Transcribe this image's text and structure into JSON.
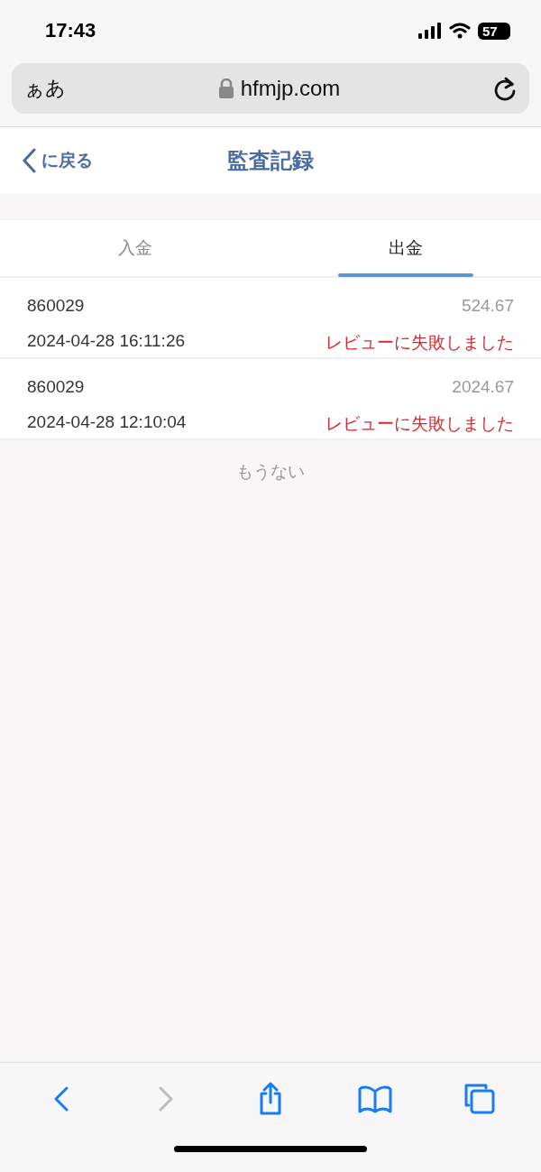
{
  "status_bar": {
    "time": "17:43",
    "battery": "57"
  },
  "browser": {
    "text_size": "ぁあ",
    "url": "hfmjp.com"
  },
  "header": {
    "back": "に戻る",
    "title": "監査記録"
  },
  "tabs": [
    {
      "label": "入金",
      "selected": false
    },
    {
      "label": "出金",
      "selected": true
    }
  ],
  "records": [
    {
      "account": "860029",
      "amount": "524.67",
      "time": "2024-04-28 16:11:26",
      "status": "レビューに失敗しました"
    },
    {
      "account": "860029",
      "amount": "2024.67",
      "time": "2024-04-28 12:10:04",
      "status": "レビューに失敗しました"
    }
  ],
  "end_note": "もうない",
  "toolbar": [
    {
      "kind": "back",
      "disabled": false
    },
    {
      "kind": "forward",
      "disabled": true
    },
    {
      "kind": "share",
      "disabled": false
    },
    {
      "kind": "bookmarks",
      "disabled": false
    },
    {
      "kind": "tabs",
      "disabled": false
    }
  ]
}
